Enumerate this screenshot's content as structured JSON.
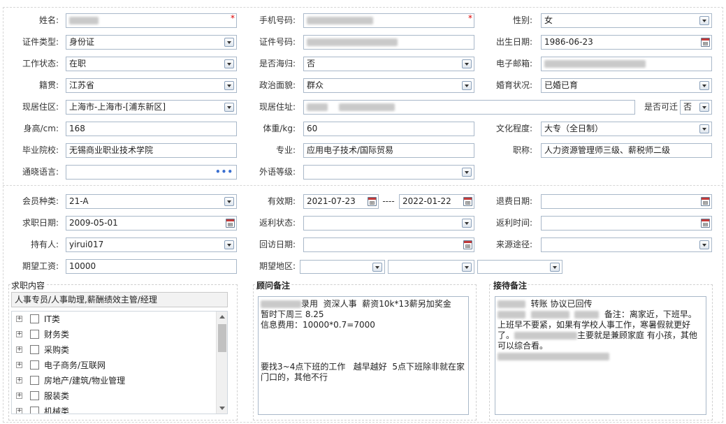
{
  "personal": {
    "name": {
      "label": "姓名:",
      "value": ""
    },
    "phone": {
      "label": "手机号码:",
      "value": ""
    },
    "gender": {
      "label": "性别:",
      "value": "女"
    },
    "id_type": {
      "label": "证件类型:",
      "value": "身份证"
    },
    "id_number": {
      "label": "证件号码:",
      "value": ""
    },
    "birth_date": {
      "label": "出生日期:",
      "value": "1986-06-23"
    },
    "work_status": {
      "label": "工作状态:",
      "value": "在职"
    },
    "returnee": {
      "label": "是否海归:",
      "value": "否"
    },
    "email": {
      "label": "电子邮箱:",
      "value": ""
    },
    "native_place": {
      "label": "籍贯:",
      "value": "江苏省"
    },
    "political": {
      "label": "政治面貌:",
      "value": "群众"
    },
    "marital": {
      "label": "婚育状况:",
      "value": "已婚已育"
    },
    "residence_area": {
      "label": "现居住区:",
      "value": "上海市-上海市-[浦东新区]"
    },
    "residence_address": {
      "label": "现居住址:",
      "value": ""
    },
    "relocate": {
      "label": "是否可迁",
      "value": "否"
    },
    "height": {
      "label": "身高/cm:",
      "value": "168"
    },
    "weight": {
      "label": "体重/kg:",
      "value": "60"
    },
    "education": {
      "label": "文化程度:",
      "value": "大专（全日制）"
    },
    "school": {
      "label": "毕业院校:",
      "value": "无锡商业职业技术学院"
    },
    "major": {
      "label": "专业:",
      "value": "应用电子技术/国际贸易"
    },
    "title": {
      "label": "职称:",
      "value": "人力资源管理师三级、薪税师二级"
    },
    "language": {
      "label": "通晓语言:",
      "value": ""
    },
    "foreign_level": {
      "label": "外语等级:",
      "value": ""
    }
  },
  "membership": {
    "member_type": {
      "label": "会员种类:",
      "value": "21-A"
    },
    "validity": {
      "label": "有效期:",
      "from": "2021-07-23",
      "sep": "----",
      "to": "2022-01-22"
    },
    "refund_date": {
      "label": "退费日期:",
      "value": ""
    },
    "job_seek_date": {
      "label": "求职日期:",
      "value": "2009-05-01"
    },
    "rebate_status": {
      "label": "返利状态:",
      "value": ""
    },
    "rebate_time": {
      "label": "返利时间:",
      "value": ""
    },
    "holder": {
      "label": "持有人:",
      "value": "yirui017"
    },
    "visit_date": {
      "label": "回访日期:",
      "value": ""
    },
    "source": {
      "label": "来源途径:",
      "value": ""
    },
    "expected_salary": {
      "label": "期望工资:",
      "value": "10000"
    },
    "expected_region": {
      "label": "期望地区:",
      "value": ""
    }
  },
  "job_content": {
    "title": "求职内容",
    "selected": "人事专员/人事助理,薪酬绩效主管/经理",
    "categories": [
      "IT类",
      "财务类",
      "采购类",
      "电子商务/互联网",
      "房地产/建筑/物业管理",
      "服装类",
      "机械类"
    ]
  },
  "advisor_notes": {
    "title": "顾问备注",
    "line1": "录用  资深人事  薪资10k*13薪另加奖金",
    "line2": "暂时下周三 8.25",
    "line3": "信息费用：10000*0.7=7000",
    "line4": "要找3~4点下班的工作   越早越好  5点下班除非就在家门口的，其他不行"
  },
  "reception_notes": {
    "title": "接待备注",
    "line1a": "转账 协议已回传",
    "line1b": "备注：离家近，下班早。上班早不要紧，如果有学校人事工作，寒暑假就更好了。",
    "line1c": "主要就是兼顾家庭 有小孩，其他可以综合看。"
  },
  "icons": {
    "dropdown": "chevron-down-icon",
    "calendar": "calendar-icon",
    "more": "ellipsis-icon",
    "expand": "plus-box-icon"
  },
  "colors": {
    "required": "#dd0000",
    "border": "#a9b8c9",
    "link_dots": "#3a6fd0"
  }
}
